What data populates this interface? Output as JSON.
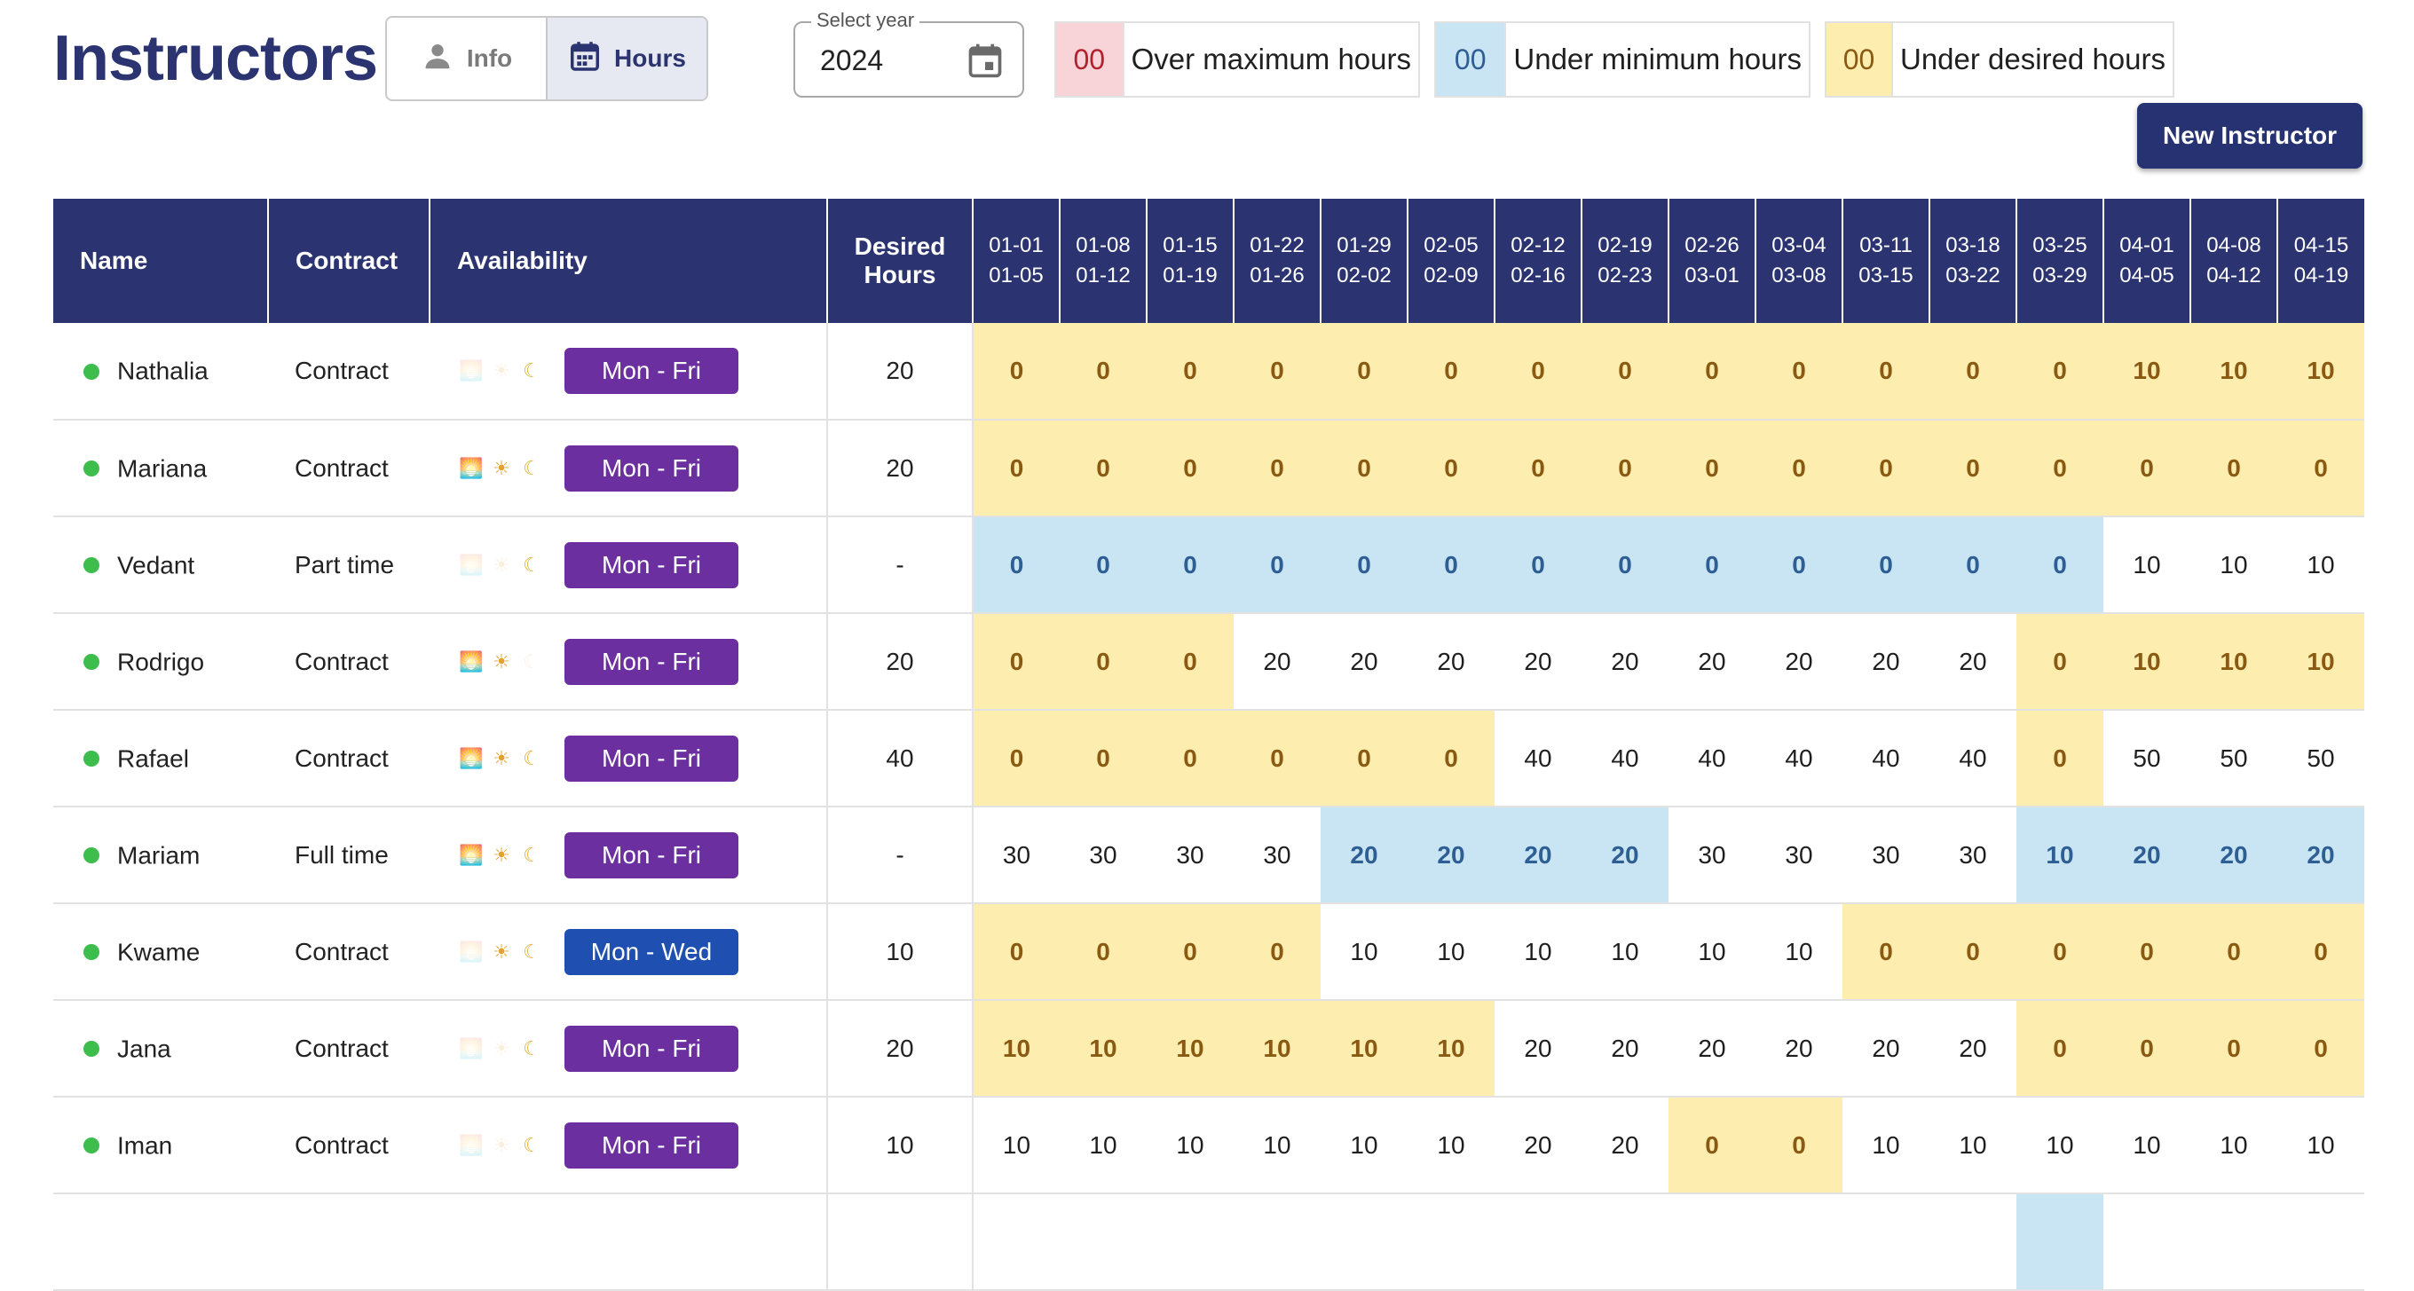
{
  "page_title": "Instructors",
  "view_toggle": {
    "info_label": "Info",
    "hours_label": "Hours",
    "active": "Hours"
  },
  "year_select": {
    "label": "Select year",
    "value": "2024"
  },
  "legend": [
    {
      "sample": "00",
      "text": "Over maximum hours",
      "color": "#f8d3d7",
      "text_color": "#b3202e"
    },
    {
      "sample": "00",
      "text": "Under minimum hours",
      "color": "#c9e4f2",
      "text_color": "#2d5e94"
    },
    {
      "sample": "00",
      "text": "Under desired hours",
      "color": "#fdeeb0",
      "text_color": "#8a5a12"
    }
  ],
  "new_instructor_label": "New Instructor",
  "table": {
    "headers": {
      "name": "Name",
      "contract": "Contract",
      "availability": "Availability",
      "desired_line1": "Desired",
      "desired_line2": "Hours"
    },
    "weeks": [
      {
        "start": "01-01",
        "end": "01-05"
      },
      {
        "start": "01-08",
        "end": "01-12"
      },
      {
        "start": "01-15",
        "end": "01-19"
      },
      {
        "start": "01-22",
        "end": "01-26"
      },
      {
        "start": "01-29",
        "end": "02-02"
      },
      {
        "start": "02-05",
        "end": "02-09"
      },
      {
        "start": "02-12",
        "end": "02-16"
      },
      {
        "start": "02-19",
        "end": "02-23"
      },
      {
        "start": "02-26",
        "end": "03-01"
      },
      {
        "start": "03-04",
        "end": "03-08"
      },
      {
        "start": "03-11",
        "end": "03-15"
      },
      {
        "start": "03-18",
        "end": "03-22"
      },
      {
        "start": "03-25",
        "end": "03-29"
      },
      {
        "start": "04-01",
        "end": "04-05"
      },
      {
        "start": "04-08",
        "end": "04-12"
      },
      {
        "start": "04-15",
        "end": "04-19"
      }
    ],
    "rows": [
      {
        "name": "Nathalia",
        "contract": "Contract",
        "morning": false,
        "day": false,
        "night": true,
        "days": "Mon - Fri",
        "days_color": "#6b2fa0",
        "desired": "20",
        "hours": [
          "0",
          "0",
          "0",
          "0",
          "0",
          "0",
          "0",
          "0",
          "0",
          "0",
          "0",
          "0",
          "0",
          "10",
          "10",
          "10"
        ],
        "status": [
          "yellow",
          "yellow",
          "yellow",
          "yellow",
          "yellow",
          "yellow",
          "yellow",
          "yellow",
          "yellow",
          "yellow",
          "yellow",
          "yellow",
          "yellow",
          "yellow",
          "yellow",
          "yellow"
        ]
      },
      {
        "name": "Mariana",
        "contract": "Contract",
        "morning": true,
        "day": true,
        "night": true,
        "days": "Mon - Fri",
        "days_color": "#6b2fa0",
        "desired": "20",
        "hours": [
          "0",
          "0",
          "0",
          "0",
          "0",
          "0",
          "0",
          "0",
          "0",
          "0",
          "0",
          "0",
          "0",
          "0",
          "0",
          "0"
        ],
        "status": [
          "yellow",
          "yellow",
          "yellow",
          "yellow",
          "yellow",
          "yellow",
          "yellow",
          "yellow",
          "yellow",
          "yellow",
          "yellow",
          "yellow",
          "yellow",
          "yellow",
          "yellow",
          "yellow"
        ]
      },
      {
        "name": "Vedant",
        "contract": "Part time",
        "morning": false,
        "day": false,
        "night": true,
        "days": "Mon - Fri",
        "days_color": "#6b2fa0",
        "desired": "-",
        "hours": [
          "0",
          "0",
          "0",
          "0",
          "0",
          "0",
          "0",
          "0",
          "0",
          "0",
          "0",
          "0",
          "0",
          "10",
          "10",
          "10"
        ],
        "status": [
          "blue",
          "blue",
          "blue",
          "blue",
          "blue",
          "blue",
          "blue",
          "blue",
          "blue",
          "blue",
          "blue",
          "blue",
          "blue",
          "white",
          "white",
          "white"
        ]
      },
      {
        "name": "Rodrigo",
        "contract": "Contract",
        "morning": true,
        "day": true,
        "night": false,
        "days": "Mon - Fri",
        "days_color": "#6b2fa0",
        "desired": "20",
        "hours": [
          "0",
          "0",
          "0",
          "20",
          "20",
          "20",
          "20",
          "20",
          "20",
          "20",
          "20",
          "20",
          "0",
          "10",
          "10",
          "10"
        ],
        "status": [
          "yellow",
          "yellow",
          "yellow",
          "white",
          "white",
          "white",
          "white",
          "white",
          "white",
          "white",
          "white",
          "white",
          "yellow",
          "yellow",
          "yellow",
          "yellow"
        ]
      },
      {
        "name": "Rafael",
        "contract": "Contract",
        "morning": true,
        "day": true,
        "night": true,
        "days": "Mon - Fri",
        "days_color": "#6b2fa0",
        "desired": "40",
        "hours": [
          "0",
          "0",
          "0",
          "0",
          "0",
          "0",
          "40",
          "40",
          "40",
          "40",
          "40",
          "40",
          "0",
          "50",
          "50",
          "50"
        ],
        "status": [
          "yellow",
          "yellow",
          "yellow",
          "yellow",
          "yellow",
          "yellow",
          "white",
          "white",
          "white",
          "white",
          "white",
          "white",
          "yellow",
          "white",
          "white",
          "white"
        ]
      },
      {
        "name": "Mariam",
        "contract": "Full time",
        "morning": true,
        "day": true,
        "night": true,
        "days": "Mon - Fri",
        "days_color": "#6b2fa0",
        "desired": "-",
        "hours": [
          "30",
          "30",
          "30",
          "30",
          "20",
          "20",
          "20",
          "20",
          "30",
          "30",
          "30",
          "30",
          "10",
          "20",
          "20",
          "20"
        ],
        "status": [
          "white",
          "white",
          "white",
          "white",
          "blue",
          "blue",
          "blue",
          "blue",
          "white",
          "white",
          "white",
          "white",
          "blue",
          "blue",
          "blue",
          "blue"
        ]
      },
      {
        "name": "Kwame",
        "contract": "Contract",
        "morning": false,
        "day": true,
        "night": true,
        "days": "Mon - Wed",
        "days_color": "#1f4fb0",
        "desired": "10",
        "hours": [
          "0",
          "0",
          "0",
          "0",
          "10",
          "10",
          "10",
          "10",
          "10",
          "10",
          "0",
          "0",
          "0",
          "0",
          "0",
          "0"
        ],
        "status": [
          "yellow",
          "yellow",
          "yellow",
          "yellow",
          "white",
          "white",
          "white",
          "white",
          "white",
          "white",
          "yellow",
          "yellow",
          "yellow",
          "yellow",
          "yellow",
          "yellow"
        ]
      },
      {
        "name": "Jana",
        "contract": "Contract",
        "morning": false,
        "day": false,
        "night": true,
        "days": "Mon - Fri",
        "days_color": "#6b2fa0",
        "desired": "20",
        "hours": [
          "10",
          "10",
          "10",
          "10",
          "10",
          "10",
          "20",
          "20",
          "20",
          "20",
          "20",
          "20",
          "0",
          "0",
          "0",
          "0"
        ],
        "status": [
          "yellow",
          "yellow",
          "yellow",
          "yellow",
          "yellow",
          "yellow",
          "white",
          "white",
          "white",
          "white",
          "white",
          "white",
          "yellow",
          "yellow",
          "yellow",
          "yellow"
        ]
      },
      {
        "name": "Iman",
        "contract": "Contract",
        "morning": false,
        "day": false,
        "night": true,
        "days": "Mon - Fri",
        "days_color": "#6b2fa0",
        "desired": "10",
        "hours": [
          "10",
          "10",
          "10",
          "10",
          "10",
          "10",
          "20",
          "20",
          "0",
          "0",
          "10",
          "10",
          "10",
          "10",
          "10",
          "10"
        ],
        "status": [
          "white",
          "white",
          "white",
          "white",
          "white",
          "white",
          "white",
          "white",
          "yellow",
          "yellow",
          "white",
          "white",
          "white",
          "white",
          "white",
          "white"
        ]
      }
    ],
    "partial_row_status": [
      "white",
      "white",
      "white",
      "white",
      "white",
      "white",
      "white",
      "white",
      "white",
      "white",
      "white",
      "white",
      "blue",
      "white",
      "white",
      "white"
    ]
  }
}
